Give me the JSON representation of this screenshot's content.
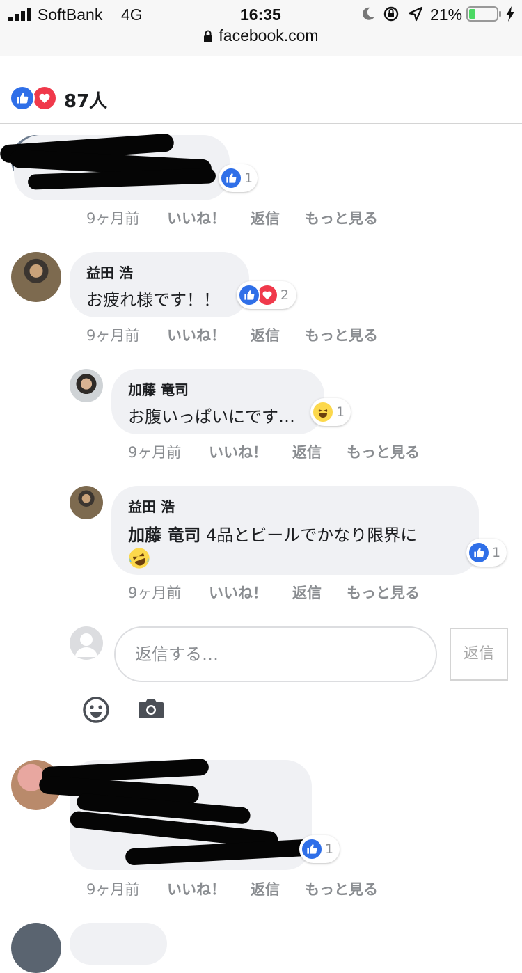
{
  "status_bar": {
    "carrier": "SoftBank",
    "network": "4G",
    "time": "16:35",
    "battery": "21%",
    "url": "facebook.com"
  },
  "reactions_summary": {
    "count": "87人"
  },
  "actions": {
    "like": "いいね！",
    "reply": "返信",
    "more": "もっと見る"
  },
  "comments": [
    {
      "time": "9ヶ月前",
      "reaction_count": "1"
    },
    {
      "name": "益田 浩",
      "text": "お疲れ様です！！",
      "time": "9ヶ月前",
      "reaction_count": "2"
    },
    {
      "name": "加藤 竜司",
      "text": "お腹いっぱいにです…",
      "time": "9ヶ月前",
      "reaction_count": "1"
    },
    {
      "name": "益田 浩",
      "mention": "加藤 竜司",
      "text": " 4品とビールでかなり限界に",
      "time": "9ヶ月前",
      "reaction_count": "1"
    },
    {
      "time": "9ヶ月前",
      "reaction_count": "1"
    }
  ],
  "reply_box": {
    "placeholder": "返信する…",
    "button": "返信"
  },
  "colors": {
    "like": "#2f6fe8",
    "love": "#f0394b",
    "bubble": "#f0f1f4",
    "meta": "#8a8d91"
  }
}
